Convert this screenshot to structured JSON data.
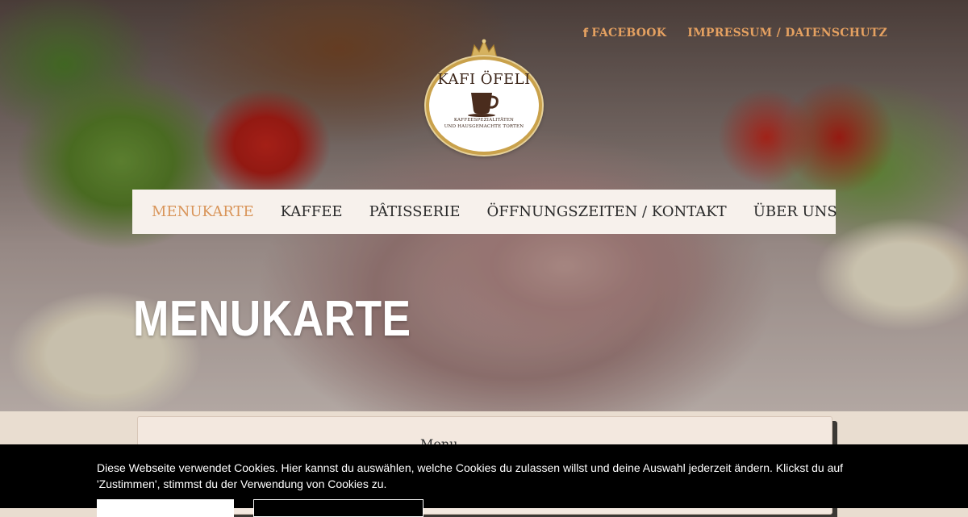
{
  "topbar": {
    "facebook_icon": "facebook-icon",
    "facebook_label": "FACEBOOK",
    "impressum_label": "IMPRESSUM / DATENSCHUTZ",
    "accent_color": "#e5a161"
  },
  "logo": {
    "title": "KAFI ÖFELI",
    "subtitle_line1": "KAFFEESPEZIALITÄTEN",
    "subtitle_line2": "UND HAUSGEMACHTE TORTEN",
    "icon": "coffee-cup-icon"
  },
  "nav": {
    "items": [
      {
        "label": "MENUKARTE",
        "active": true
      },
      {
        "label": "KAFFEE",
        "active": false
      },
      {
        "label": "PÂTISSERIE",
        "active": false
      },
      {
        "label": "ÖFFNUNGSZEITEN / KONTAKT",
        "active": false
      },
      {
        "label": "ÜBER UNS",
        "active": false
      }
    ],
    "active_color": "#d9955a"
  },
  "page": {
    "title": "MENUKARTE"
  },
  "content": {
    "card_heading": "Menu"
  },
  "cookie_banner": {
    "text": "Diese Webseite verwendet Cookies. Hier kannst du auswählen, welche Cookies du zulassen willst und deine Auswahl jederzeit ändern. Klickst du auf 'Zustimmen', stimmst du der Verwendung von Cookies zu.",
    "button_primary_label": "",
    "button_secondary_label": ""
  }
}
